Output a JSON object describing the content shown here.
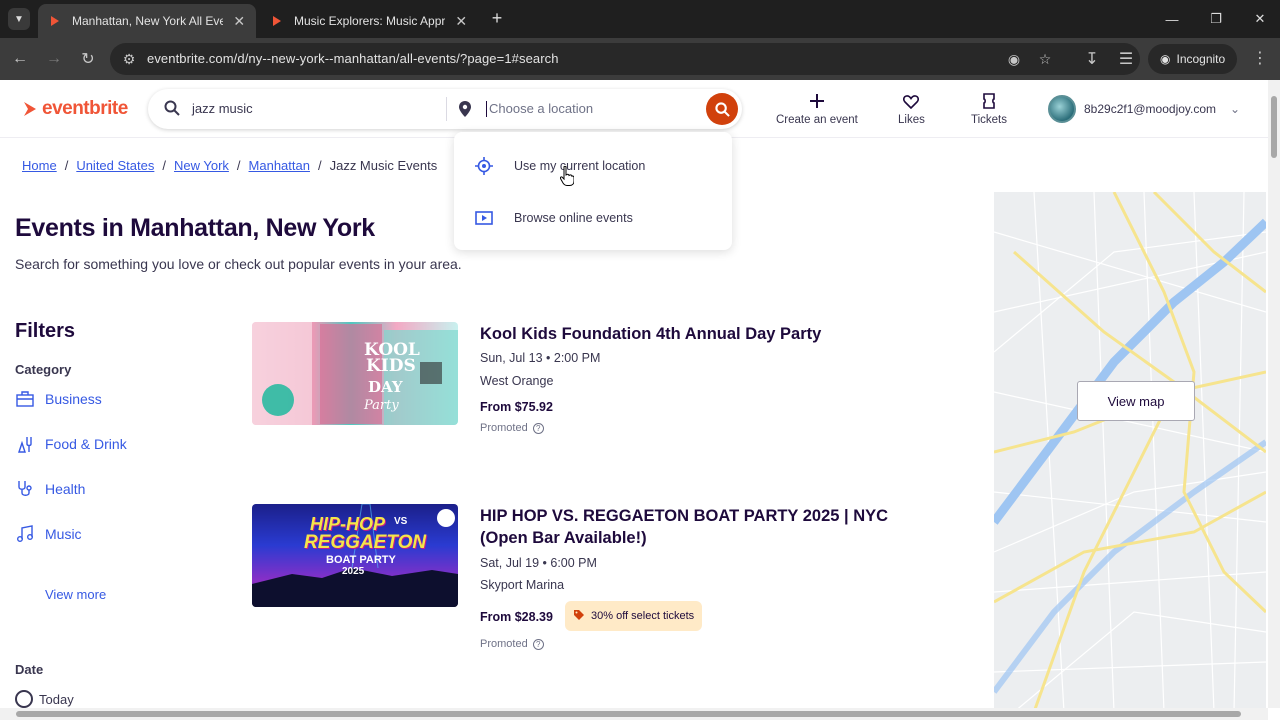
{
  "browser": {
    "tabs": [
      {
        "title": "Manhattan, New York All Events",
        "active": true
      },
      {
        "title": "Music Explorers: Music Apprec",
        "active": false
      }
    ],
    "url": "eventbrite.com/d/ny--new-york--manhattan/all-events/?page=1#search",
    "incognito_label": "Incognito"
  },
  "header": {
    "logo": "eventbrite",
    "search_query": "jazz music",
    "location_placeholder": "Choose a location",
    "nav": [
      {
        "label": "Create an event",
        "icon": "plus-icon"
      },
      {
        "label": "Likes",
        "icon": "heart-icon"
      },
      {
        "label": "Tickets",
        "icon": "ticket-icon"
      }
    ],
    "account_email": "8b29c2f1@moodjoy.com"
  },
  "location_dropdown": {
    "items": [
      {
        "label": "Use my current location",
        "icon": "crosshair-icon"
      },
      {
        "label": "Browse online events",
        "icon": "play-screen-icon"
      }
    ]
  },
  "breadcrumb": [
    "Home",
    "United States",
    "New York",
    "Manhattan",
    "Jazz Music Events"
  ],
  "page": {
    "title": "Events in Manhattan, New York",
    "subtitle": "Search for something you love or check out popular events in your area."
  },
  "filters": {
    "heading": "Filters",
    "category_heading": "Category",
    "categories": [
      "Business",
      "Food & Drink",
      "Health",
      "Music"
    ],
    "view_more": "View more",
    "date_heading": "Date",
    "date_first_option": "Today"
  },
  "events": [
    {
      "title": "Kool Kids Foundation 4th Annual Day Party",
      "date": "Sun, Jul 13 • 2:00 PM",
      "venue": "West Orange",
      "price": "From $75.92",
      "promoted": "Promoted",
      "image_text": [
        "KOOL",
        "KIDS",
        "DAY",
        "Party"
      ]
    },
    {
      "title": "HIP HOP VS. REGGAETON BOAT PARTY 2025 | NYC (Open Bar Available!)",
      "date": "Sat, Jul 19 • 6:00 PM",
      "venue": "Skyport Marina",
      "price": "From $28.39",
      "badge": "30% off select tickets",
      "promoted": "Promoted",
      "image_text": [
        "HIP-HOP",
        "VS",
        "REGGAETON",
        "BOAT PARTY",
        "2025"
      ]
    }
  ],
  "map": {
    "button": "View map"
  },
  "colors": {
    "brand": "#f05537",
    "link": "#3659e3",
    "search_button": "#d1410c",
    "badge_bg": "#ffeac7"
  }
}
